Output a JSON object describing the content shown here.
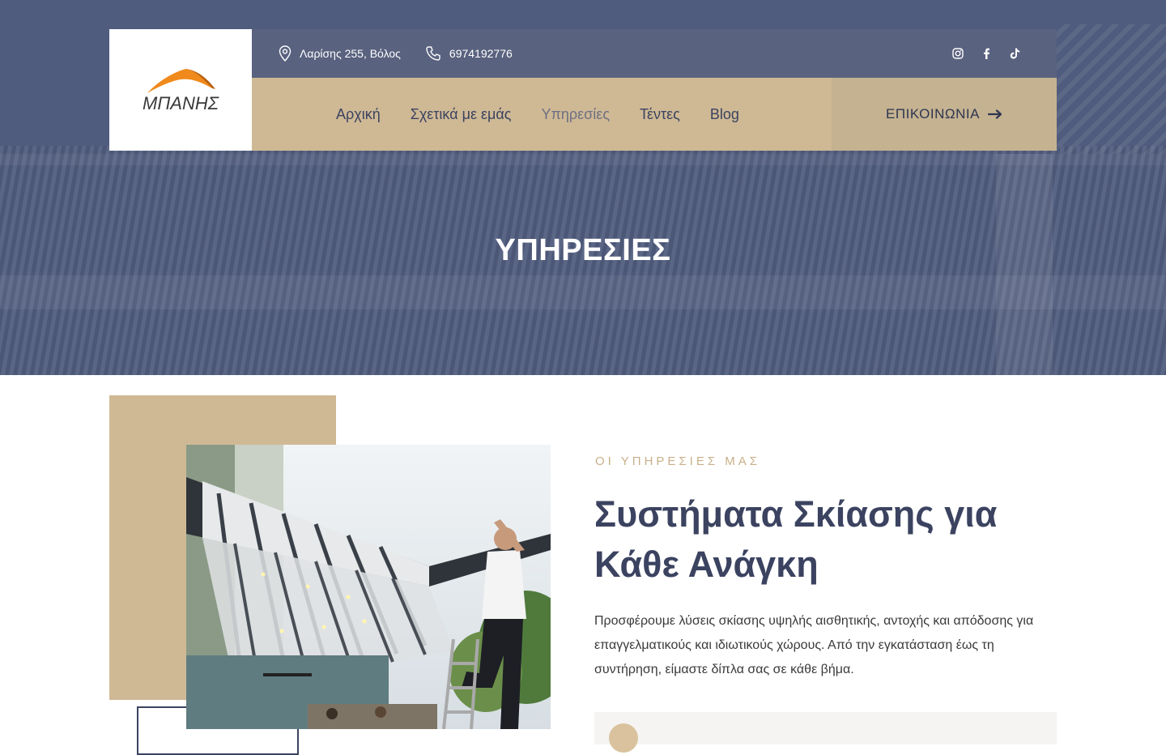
{
  "header": {
    "logo_text": "ΜΠΑΝΗΣ",
    "address": "Λαρίσης 255, Βόλος",
    "phone": "6974192776",
    "social": [
      "instagram-icon",
      "facebook-icon",
      "tiktok-icon"
    ]
  },
  "nav": {
    "items": [
      {
        "label": "Αρχική"
      },
      {
        "label": "Σχετικά με εμάς"
      },
      {
        "label": "Υπηρεσίες"
      },
      {
        "label": "Τέντες"
      },
      {
        "label": "Blog"
      }
    ],
    "active_index": 2,
    "cta_label": "ΕΠΙΚΟΙΝΩΝΙΑ"
  },
  "hero": {
    "title": "ΥΠΗΡΕΣΙΕΣ"
  },
  "section": {
    "eyebrow": "ΟΙ ΥΠΗΡΕΣΙΕΣ ΜΑΣ",
    "heading": "Συστήματα Σκίασης για Κάθε Ανάγκη",
    "description": "Προσφέρουμε λύσεις σκίασης υψηλής αισθητικής, αντοχής και απόδοσης για επαγγελματικούς και ιδιωτικούς χώρους. Από την εγκατάσταση έως τη συντήρηση, είμαστε δίπλα σας σε κάθε βήμα."
  },
  "colors": {
    "navy": "#3b4360",
    "tan": "#cfb995",
    "hero_overlay": "#505c7d",
    "topbar": "#59627f",
    "logo_orange": "#f08a1c"
  }
}
